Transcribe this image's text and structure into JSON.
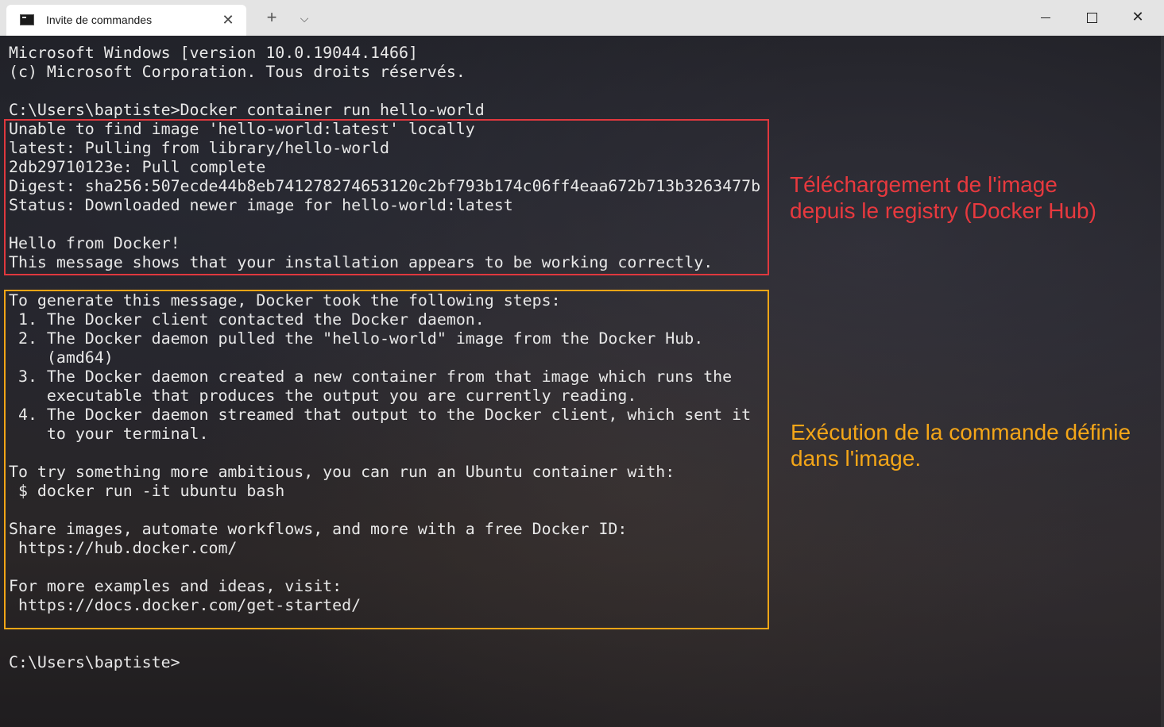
{
  "window": {
    "tab_title": "Invite de commandes",
    "tab_close": "✕",
    "new_tab": "+",
    "dropdown": "⌵",
    "close": "✕"
  },
  "terminal": {
    "lines": [
      "Microsoft Windows [version 10.0.19044.1466]",
      "(c) Microsoft Corporation. Tous droits réservés.",
      "",
      "C:\\Users\\baptiste>Docker container run hello-world",
      "Unable to find image 'hello-world:latest' locally",
      "latest: Pulling from library/hello-world",
      "2db29710123e: Pull complete",
      "Digest: sha256:507ecde44b8eb741278274653120c2bf793b174c06ff4eaa672b713b3263477b",
      "Status: Downloaded newer image for hello-world:latest",
      "",
      "Hello from Docker!",
      "This message shows that your installation appears to be working correctly.",
      "",
      "To generate this message, Docker took the following steps:",
      " 1. The Docker client contacted the Docker daemon.",
      " 2. The Docker daemon pulled the \"hello-world\" image from the Docker Hub.",
      "    (amd64)",
      " 3. The Docker daemon created a new container from that image which runs the",
      "    executable that produces the output you are currently reading.",
      " 4. The Docker daemon streamed that output to the Docker client, which sent it",
      "    to your terminal.",
      "",
      "To try something more ambitious, you can run an Ubuntu container with:",
      " $ docker run -it ubuntu bash",
      "",
      "Share images, automate workflows, and more with a free Docker ID:",
      " https://hub.docker.com/",
      "",
      "For more examples and ideas, visit:",
      " https://docs.docker.com/get-started/",
      "",
      "",
      "C:\\Users\\baptiste>"
    ]
  },
  "annotations": {
    "pull": "Téléchargement de l'image\ndepuis le registry (Docker Hub)",
    "execution": "Exécution de la commande définie\ndans l'image."
  },
  "colors": {
    "red_annotation": "#e0383e",
    "yellow_annotation": "#f2a516"
  }
}
